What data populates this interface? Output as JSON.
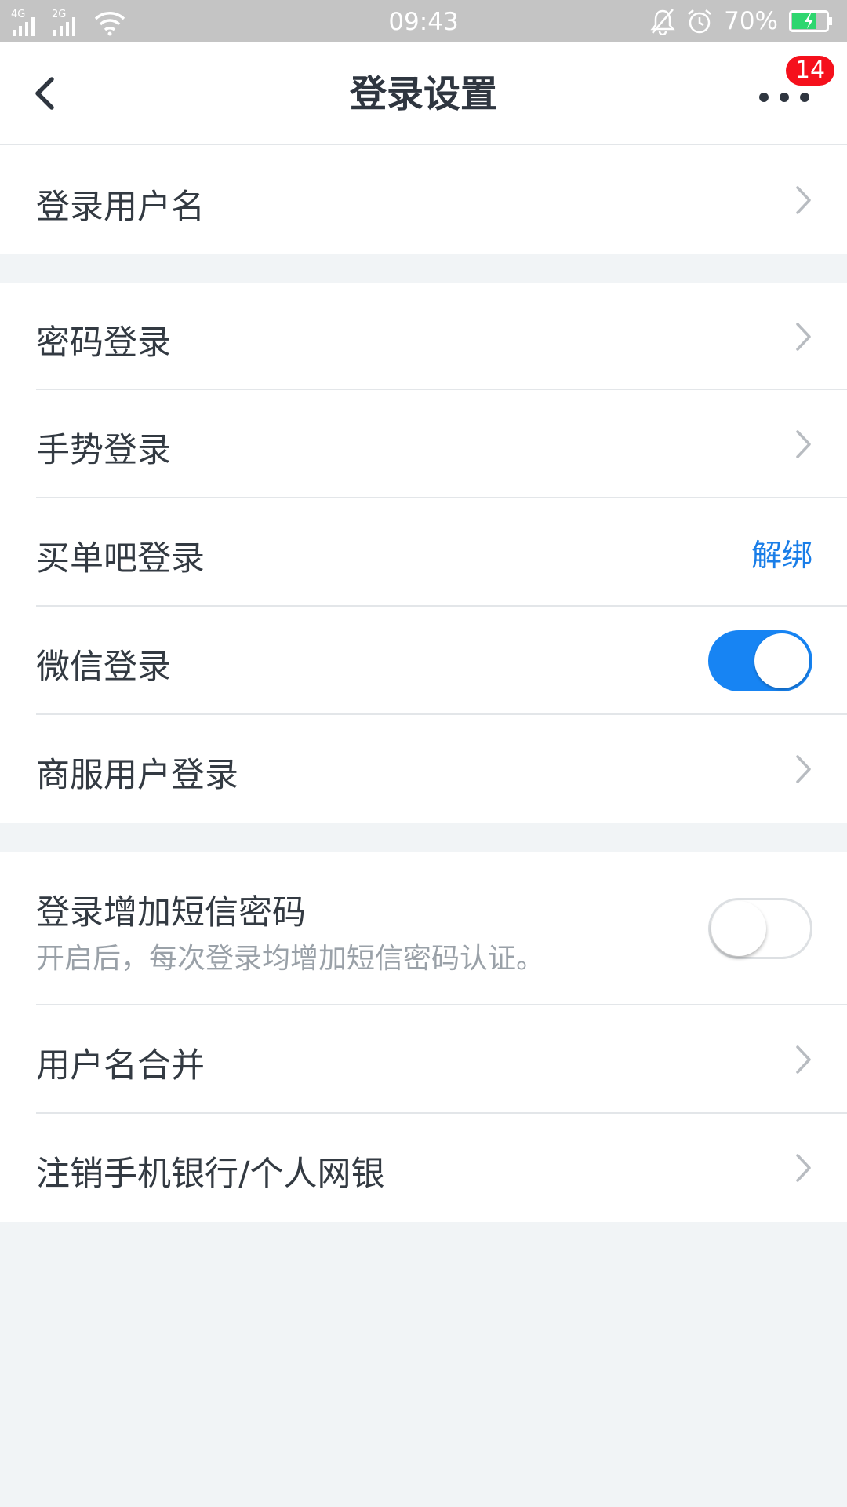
{
  "status_bar": {
    "network_1": "4G",
    "network_2": "2G",
    "time": "09:43",
    "battery_percent": "70%",
    "battery_level": 0.7,
    "icons": [
      "signal-icon",
      "signal-icon",
      "wifi-icon",
      "bell-muted-icon",
      "alarm-icon",
      "battery-charging-icon"
    ]
  },
  "nav": {
    "title": "登录设置",
    "badge_count": "14",
    "back_icon": "back-chevron-icon",
    "more_icon": "more-dots-icon"
  },
  "groups": [
    {
      "rows": [
        {
          "label": "登录用户名",
          "accessory": "chevron"
        }
      ]
    },
    {
      "rows": [
        {
          "label": "密码登录",
          "accessory": "chevron"
        },
        {
          "label": "手势登录",
          "accessory": "chevron"
        },
        {
          "label": "买单吧登录",
          "accessory": "link",
          "link_text": "解绑"
        },
        {
          "label": "微信登录",
          "accessory": "toggle",
          "toggle_on": true
        },
        {
          "label": "商服用户登录",
          "accessory": "chevron"
        }
      ]
    },
    {
      "rows": [
        {
          "label": "登录增加短信密码",
          "sublabel": "开启后，每次登录均增加短信密码认证。",
          "accessory": "toggle",
          "toggle_on": false
        },
        {
          "label": "用户名合并",
          "accessory": "chevron"
        },
        {
          "label": "注销手机银行/个人网银",
          "accessory": "chevron"
        }
      ]
    }
  ],
  "colors": {
    "accent": "#1784f3",
    "link": "#1a7ee8",
    "badge": "#f5101c",
    "background": "#f1f4f6"
  }
}
